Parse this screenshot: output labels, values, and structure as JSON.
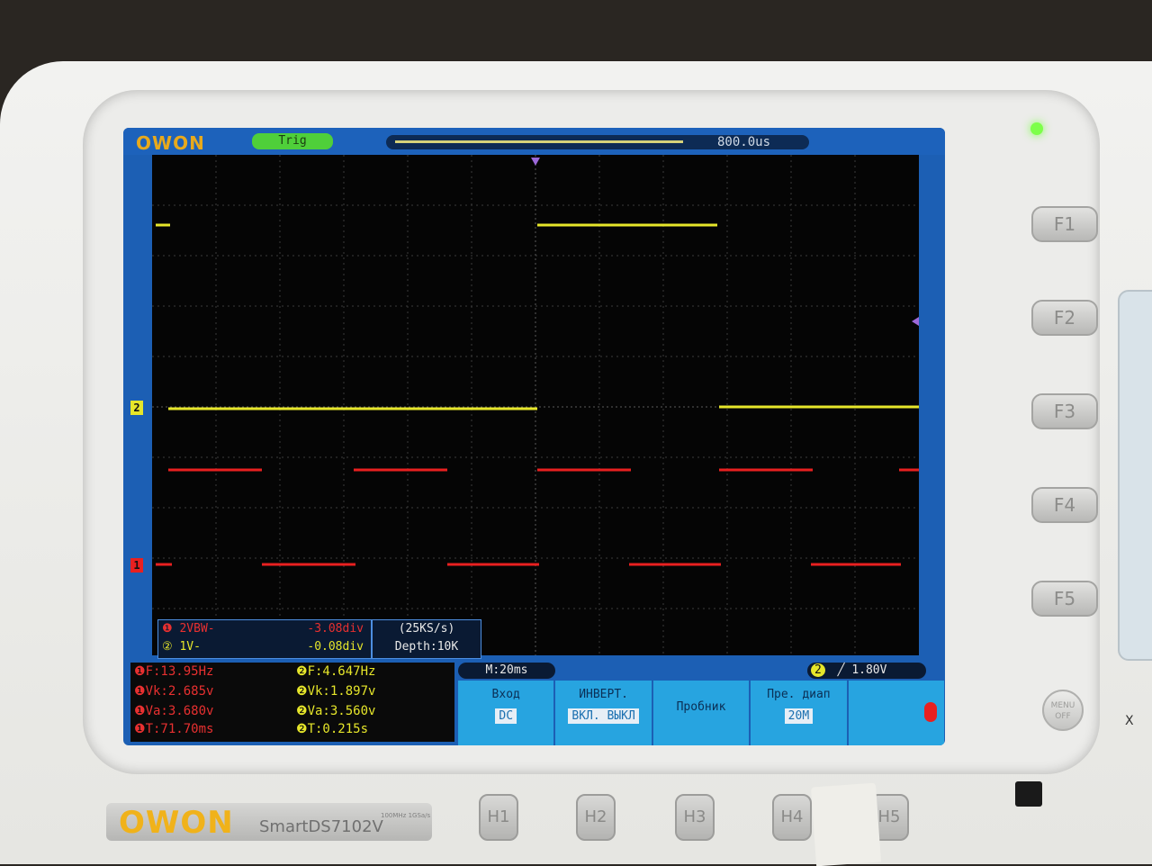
{
  "screen": {
    "brand_small": "OWON",
    "trig_label": "Trig",
    "time_offset": "800.0us",
    "ch2_marker": "2",
    "ch1_marker": "1"
  },
  "measure_box": {
    "row1_label": "❶ 2VBW-",
    "row1_value": "-3.08div",
    "row2_label": "② 1V-",
    "row2_value": "-0.08div"
  },
  "rate_box": {
    "rate": "(25KS/s)",
    "depth": "Depth:10K"
  },
  "stats": {
    "ch1_f": "F:13.95Hz",
    "ch1_vk": "Vk:2.685v",
    "ch1_va": "Va:3.680v",
    "ch1_t": "T:71.70ms",
    "ch2_f": "F:4.647Hz",
    "ch2_vk": "Vk:1.897v",
    "ch2_va": "Va:3.560v",
    "ch2_t": "T:0.215s"
  },
  "timebase": "M:20ms",
  "trigger_level": "1.80V",
  "menu": [
    {
      "title": "Вход",
      "value": "DC"
    },
    {
      "title": "ИНВЕРТ.",
      "value": "ВКЛ. ВЫКЛ"
    },
    {
      "title": "Пробник",
      "value": ""
    },
    {
      "title": "Пре. диап",
      "value": "20M"
    },
    {
      "title": "",
      "value": ""
    }
  ],
  "fkeys": [
    "F1",
    "F2",
    "F3",
    "F4",
    "F5"
  ],
  "hkeys": [
    "H1",
    "H2",
    "H3",
    "H4",
    "H5"
  ],
  "menu_off": "MENU OFF",
  "brand": {
    "logo": "OWON",
    "model": "SmartDS7102V",
    "spec": "100MHz 1GSa/s"
  },
  "side_x": "X",
  "colors": {
    "ch1": "#e82020",
    "ch2": "#e6e62a",
    "screen_blue": "#1c5fb4",
    "menu_blue": "#27a4e0"
  }
}
